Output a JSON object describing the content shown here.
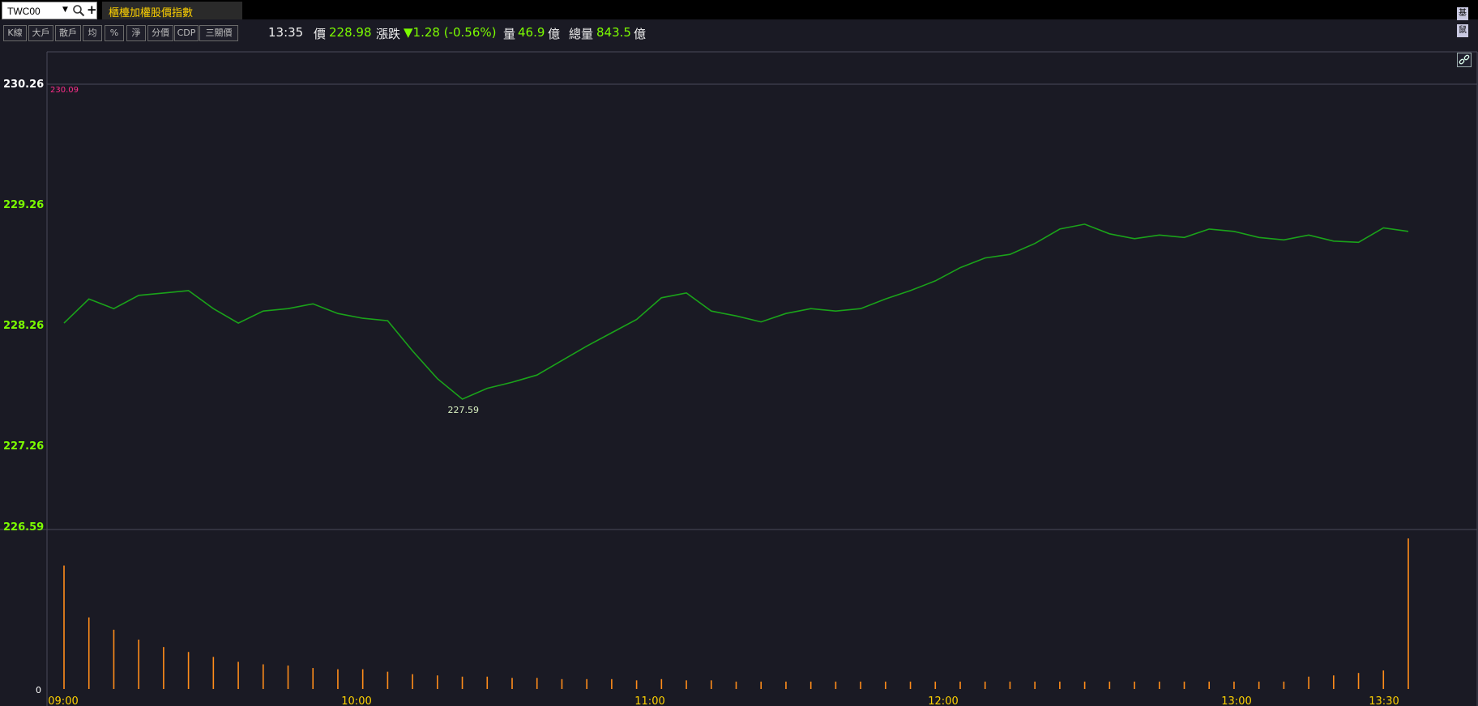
{
  "header": {
    "symbol": "TWC00",
    "title": "櫃檯加權股價指數",
    "corner_buttons": [
      "基",
      "鼠"
    ]
  },
  "toolbar": {
    "buttons": [
      "K線",
      "大戶",
      "散戶",
      "均",
      "%",
      "淨",
      "分價",
      "CDP",
      "三關價"
    ]
  },
  "quote": {
    "time": "13:35",
    "price_label": "價",
    "price": "228.98",
    "change_label": "漲跌",
    "change": "▼1.28 (-0.56%)",
    "volume_label": "量",
    "volume": "46.9",
    "volume_unit": "億",
    "total_label": "總量",
    "total": "843.5",
    "total_unit": "億"
  },
  "colors": {
    "background": "#1a1a24",
    "line": "#1aa31a",
    "volume": "#ff8c1a",
    "positive_label": "#7cfc00",
    "ref_label": "#ff2d8a",
    "time_label": "#ffd200"
  },
  "icons": {
    "search": "magnifier-icon",
    "link": "link-icon"
  },
  "chart_data": {
    "type": "line",
    "title": "",
    "xlabel": "",
    "ylabel": "",
    "price_axis": {
      "ticks": [
        "230.26",
        "229.26",
        "228.26",
        "227.26",
        "226.59"
      ],
      "tick_values": [
        230.26,
        229.26,
        228.26,
        227.26,
        226.59
      ],
      "ylim": [
        226.59,
        230.26
      ]
    },
    "volume_axis": {
      "ticks": [
        "0"
      ]
    },
    "x_ticks": [
      "09:00",
      "10:00",
      "11:00",
      "12:00",
      "13:00",
      "13:30"
    ],
    "reference_label": "230.09",
    "low_label": "227.59",
    "series": [
      {
        "x": [
          "09:00",
          "09:05",
          "09:10",
          "09:15",
          "09:20",
          "09:25",
          "09:30",
          "09:35",
          "09:40",
          "09:45",
          "09:50",
          "09:55",
          "10:00",
          "10:05",
          "10:10",
          "10:15",
          "10:20",
          "10:25",
          "10:30",
          "10:35",
          "10:40",
          "10:45",
          "10:50",
          "10:55",
          "11:00",
          "11:05",
          "11:10",
          "11:15",
          "11:20",
          "11:25",
          "11:30",
          "11:35",
          "11:40",
          "11:45",
          "11:50",
          "11:55",
          "12:00",
          "12:05",
          "12:10",
          "12:15",
          "12:20",
          "12:25",
          "12:30",
          "12:35",
          "12:40",
          "12:45",
          "12:50",
          "12:55",
          "13:00",
          "13:05",
          "13:10",
          "13:15",
          "13:20",
          "13:25",
          "13:30"
        ],
        "values": [
          228.28,
          228.48,
          228.4,
          228.51,
          228.53,
          228.55,
          228.4,
          228.28,
          228.38,
          228.4,
          228.44,
          228.36,
          228.32,
          228.3,
          228.05,
          227.82,
          227.65,
          227.74,
          227.79,
          227.85,
          227.97,
          228.09,
          228.2,
          228.31,
          228.49,
          228.53,
          228.38,
          228.34,
          228.29,
          228.36,
          228.4,
          228.38,
          228.4,
          228.48,
          228.55,
          228.63,
          228.74,
          228.82,
          228.85,
          228.94,
          229.06,
          229.1,
          229.02,
          228.98,
          229.01,
          228.99,
          229.06,
          229.04,
          228.99,
          228.97,
          229.01,
          228.96,
          228.95,
          229.07,
          229.04
        ]
      }
    ],
    "volume_series": {
      "x": [
        "09:00",
        "09:05",
        "09:10",
        "09:15",
        "09:20",
        "09:25",
        "09:30",
        "09:35",
        "09:40",
        "09:45",
        "09:50",
        "09:55",
        "10:00",
        "10:05",
        "10:10",
        "10:15",
        "10:20",
        "10:25",
        "10:30",
        "10:35",
        "10:40",
        "10:45",
        "10:50",
        "10:55",
        "11:00",
        "11:05",
        "11:10",
        "11:15",
        "11:20",
        "11:25",
        "11:30",
        "11:35",
        "11:40",
        "11:45",
        "11:50",
        "11:55",
        "12:00",
        "12:05",
        "12:10",
        "12:15",
        "12:20",
        "12:25",
        "12:30",
        "12:35",
        "12:40",
        "12:45",
        "12:50",
        "12:55",
        "13:00",
        "13:05",
        "13:10",
        "13:15",
        "13:20",
        "13:25",
        "13:30"
      ],
      "values": [
        100,
        58,
        48,
        40,
        34,
        30,
        26,
        22,
        20,
        19,
        17,
        16,
        16,
        14,
        12,
        11,
        10,
        10,
        9,
        9,
        8,
        8,
        8,
        7,
        8,
        7,
        7,
        6,
        6,
        6,
        6,
        6,
        6,
        6,
        6,
        6,
        6,
        6,
        6,
        6,
        6,
        6,
        6,
        6,
        6,
        6,
        6,
        6,
        6,
        6,
        10,
        11,
        13,
        15,
        122
      ]
    }
  }
}
